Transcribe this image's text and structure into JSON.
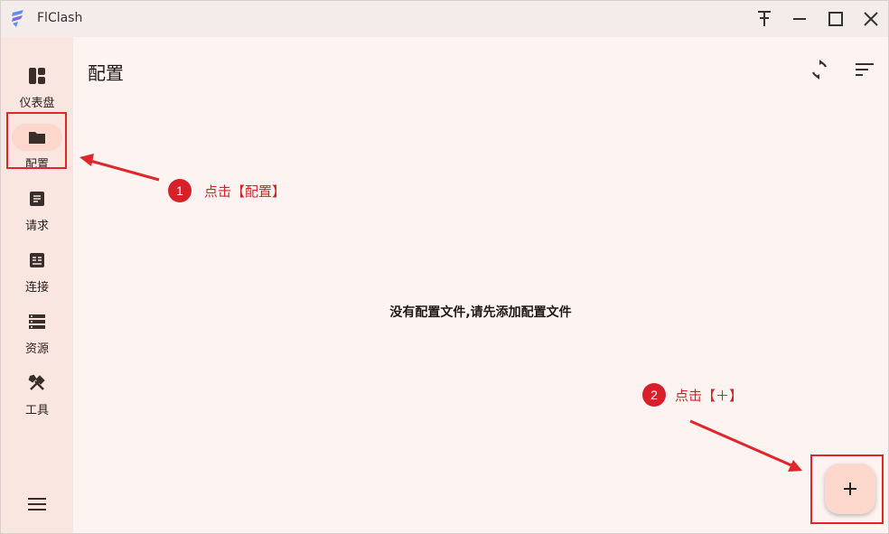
{
  "app": {
    "title": "FlClash"
  },
  "window_controls": [
    "pin-icon",
    "minimize-icon",
    "maximize-icon",
    "close-icon"
  ],
  "sidebar": {
    "items": [
      {
        "label": "仪表盘",
        "icon": "dashboard-icon"
      },
      {
        "label": "配置",
        "icon": "folder-icon",
        "active": true
      },
      {
        "label": "请求",
        "icon": "request-icon"
      },
      {
        "label": "连接",
        "icon": "connection-icon"
      },
      {
        "label": "资源",
        "icon": "resource-icon"
      },
      {
        "label": "工具",
        "icon": "tools-icon"
      }
    ],
    "menu_icon": "hamburger-menu-icon"
  },
  "main": {
    "title": "配置",
    "toolbar": [
      "sync-icon",
      "sort-icon"
    ],
    "empty_message": "没有配置文件,请先添加配置文件",
    "fab_icon": "plus-icon"
  },
  "annotations": {
    "step1": {
      "number": "1",
      "text": "点击【配置】"
    },
    "step2": {
      "number": "2",
      "text": "点击【＋】"
    }
  },
  "colors": {
    "background": "#fdf4f1",
    "sidebar": "#fae6e0",
    "active_pill": "#fbd7cc",
    "annotation": "#e0252b"
  }
}
